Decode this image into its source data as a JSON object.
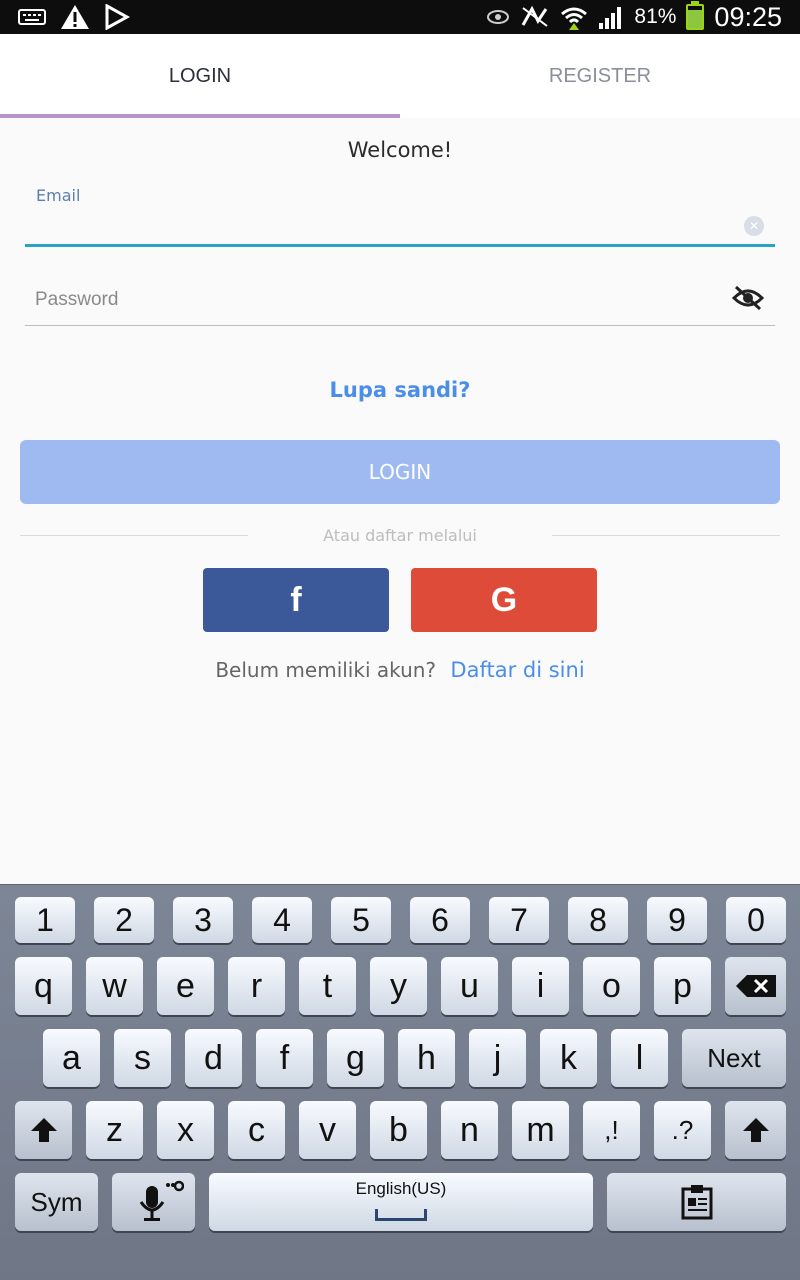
{
  "status_bar": {
    "battery": "81%",
    "time": "09:25",
    "icons": [
      "keyboard-icon",
      "warning-icon",
      "play-store-icon",
      "eye-icon",
      "no-signal-icon",
      "wifi-icon",
      "signal-icon",
      "battery-icon"
    ],
    "battery_level": 0.81
  },
  "tabs": {
    "login": "LOGIN",
    "register": "REGISTER"
  },
  "form": {
    "welcome": "Welcome!",
    "email_label": "Email",
    "email_value": "",
    "password_placeholder": "Password",
    "forgot": "Lupa sandi?",
    "login_button": "LOGIN",
    "divider_text": "Atau daftar melalui",
    "signup_prompt": "Belum memiliki akun?",
    "signup_link": "Daftar di sini"
  },
  "social": {
    "facebook_glyph": "f",
    "google_glyph": "G"
  },
  "keyboard": {
    "row_numbers": [
      "1",
      "2",
      "3",
      "4",
      "5",
      "6",
      "7",
      "8",
      "9",
      "0"
    ],
    "row1": [
      "q",
      "w",
      "e",
      "r",
      "t",
      "y",
      "u",
      "i",
      "o",
      "p"
    ],
    "row2": [
      "a",
      "s",
      "d",
      "f",
      "g",
      "h",
      "j",
      "k",
      "l"
    ],
    "row3": [
      "z",
      "x",
      "c",
      "v",
      "b",
      "n",
      "m"
    ],
    "comma_key": ",!",
    "period_key": ".?",
    "next": "Next",
    "sym": "Sym",
    "space_label": "English(US)"
  },
  "colors": {
    "accent_blue": "#4a8ee8",
    "login_button": "#9fbaf0",
    "facebook": "#3b5998",
    "google": "#de4b39",
    "tab_indicator": "#b994c9",
    "email_underline": "#2aa4c2"
  }
}
